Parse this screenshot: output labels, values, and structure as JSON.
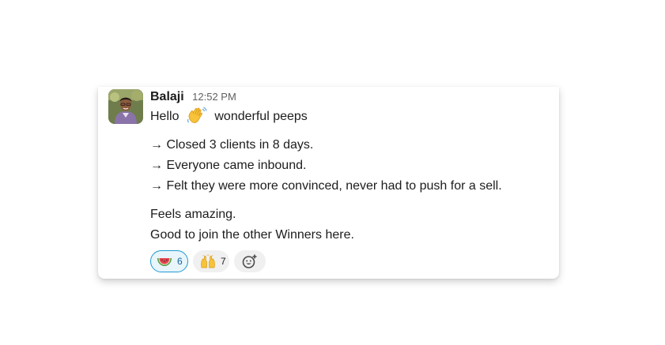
{
  "message": {
    "author": "Balaji",
    "timestamp": "12:52 PM",
    "greeting_before": "Hello",
    "greeting_emoji": "waving-hand",
    "greeting_after": "wonderful peeps",
    "bullets": [
      "→ Closed 3 clients in 8 days.",
      "→ Everyone came inbound.",
      "→ Felt they were more convinced, never had to push for a sell."
    ],
    "closing": [
      "Feels amazing.",
      "Good to join the other Winners here."
    ]
  },
  "reactions": [
    {
      "emoji": "watermelon",
      "count": "6",
      "selected": true
    },
    {
      "emoji": "raised-hands",
      "count": "7",
      "selected": false
    }
  ],
  "add_reaction_icon": "add-reaction-icon",
  "colors": {
    "selected_border": "#1d9bd1",
    "selected_bg": "#e8f5fa",
    "selected_text": "#1264a3",
    "pill_bg": "#f0f0f0",
    "timestamp": "#616061"
  }
}
